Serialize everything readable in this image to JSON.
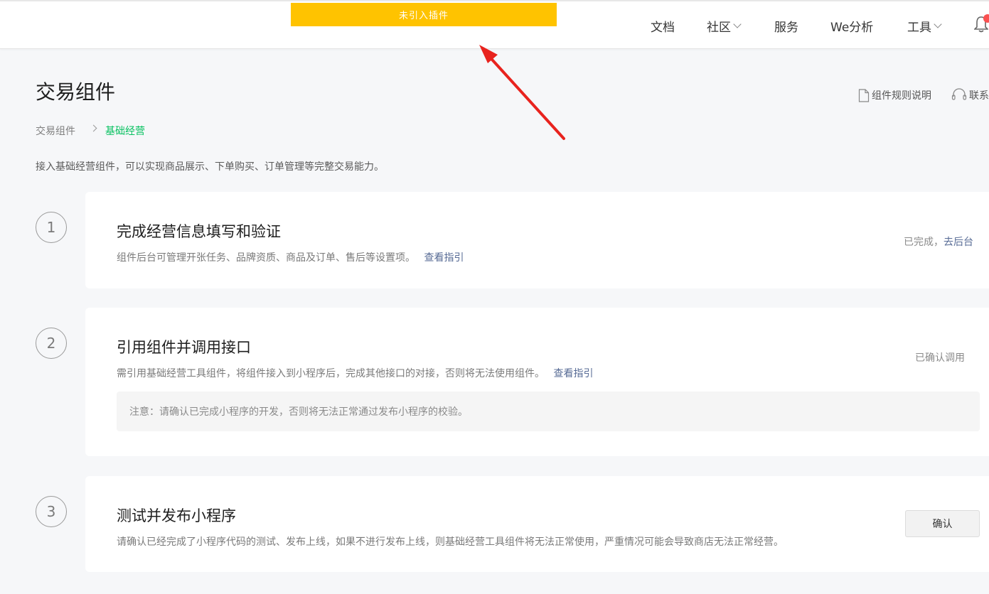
{
  "notice": "未引入插件",
  "nav": {
    "docs": "文档",
    "community": "社区",
    "service": "服务",
    "we_analysis": "We分析",
    "tools": "工具"
  },
  "page_title": "交易组件",
  "help": {
    "rules": "组件规则说明",
    "contact": "联系"
  },
  "breadcrumb": {
    "parent": "交易组件",
    "current": "基础经营"
  },
  "description": "接入基础经营组件，可以实现商品展示、下单购买、订单管理等完整交易能力。",
  "steps": [
    {
      "number": "1",
      "title": "完成经营信息填写和验证",
      "text": "组件后台可管理开张任务、品牌资质、商品及订单、售后等设置项。",
      "link": "查看指引",
      "status": "已完成，",
      "status_link": "去后台"
    },
    {
      "number": "2",
      "title": "引用组件并调用接口",
      "text": "需引用基础经营工具组件，将组件接入到小程序后，完成其他接口的对接，否则将无法使用组件。",
      "link": "查看指引",
      "status": "已确认调用",
      "note": "注意：请确认已完成小程序的开发，否则将无法正常通过发布小程序的校验。"
    },
    {
      "number": "3",
      "title": "测试并发布小程序",
      "text": "请确认已经完成了小程序代码的测试、发布上线，如果不进行发布上线，则基础经营工具组件将无法正常使用，严重情况可能会导致商店无法正常经营。",
      "button": "确认"
    }
  ],
  "colors": {
    "notice_bg": "#ffc300",
    "brand_green": "#07c160",
    "link_blue": "#576b95",
    "arrow_red": "#e8231e"
  }
}
